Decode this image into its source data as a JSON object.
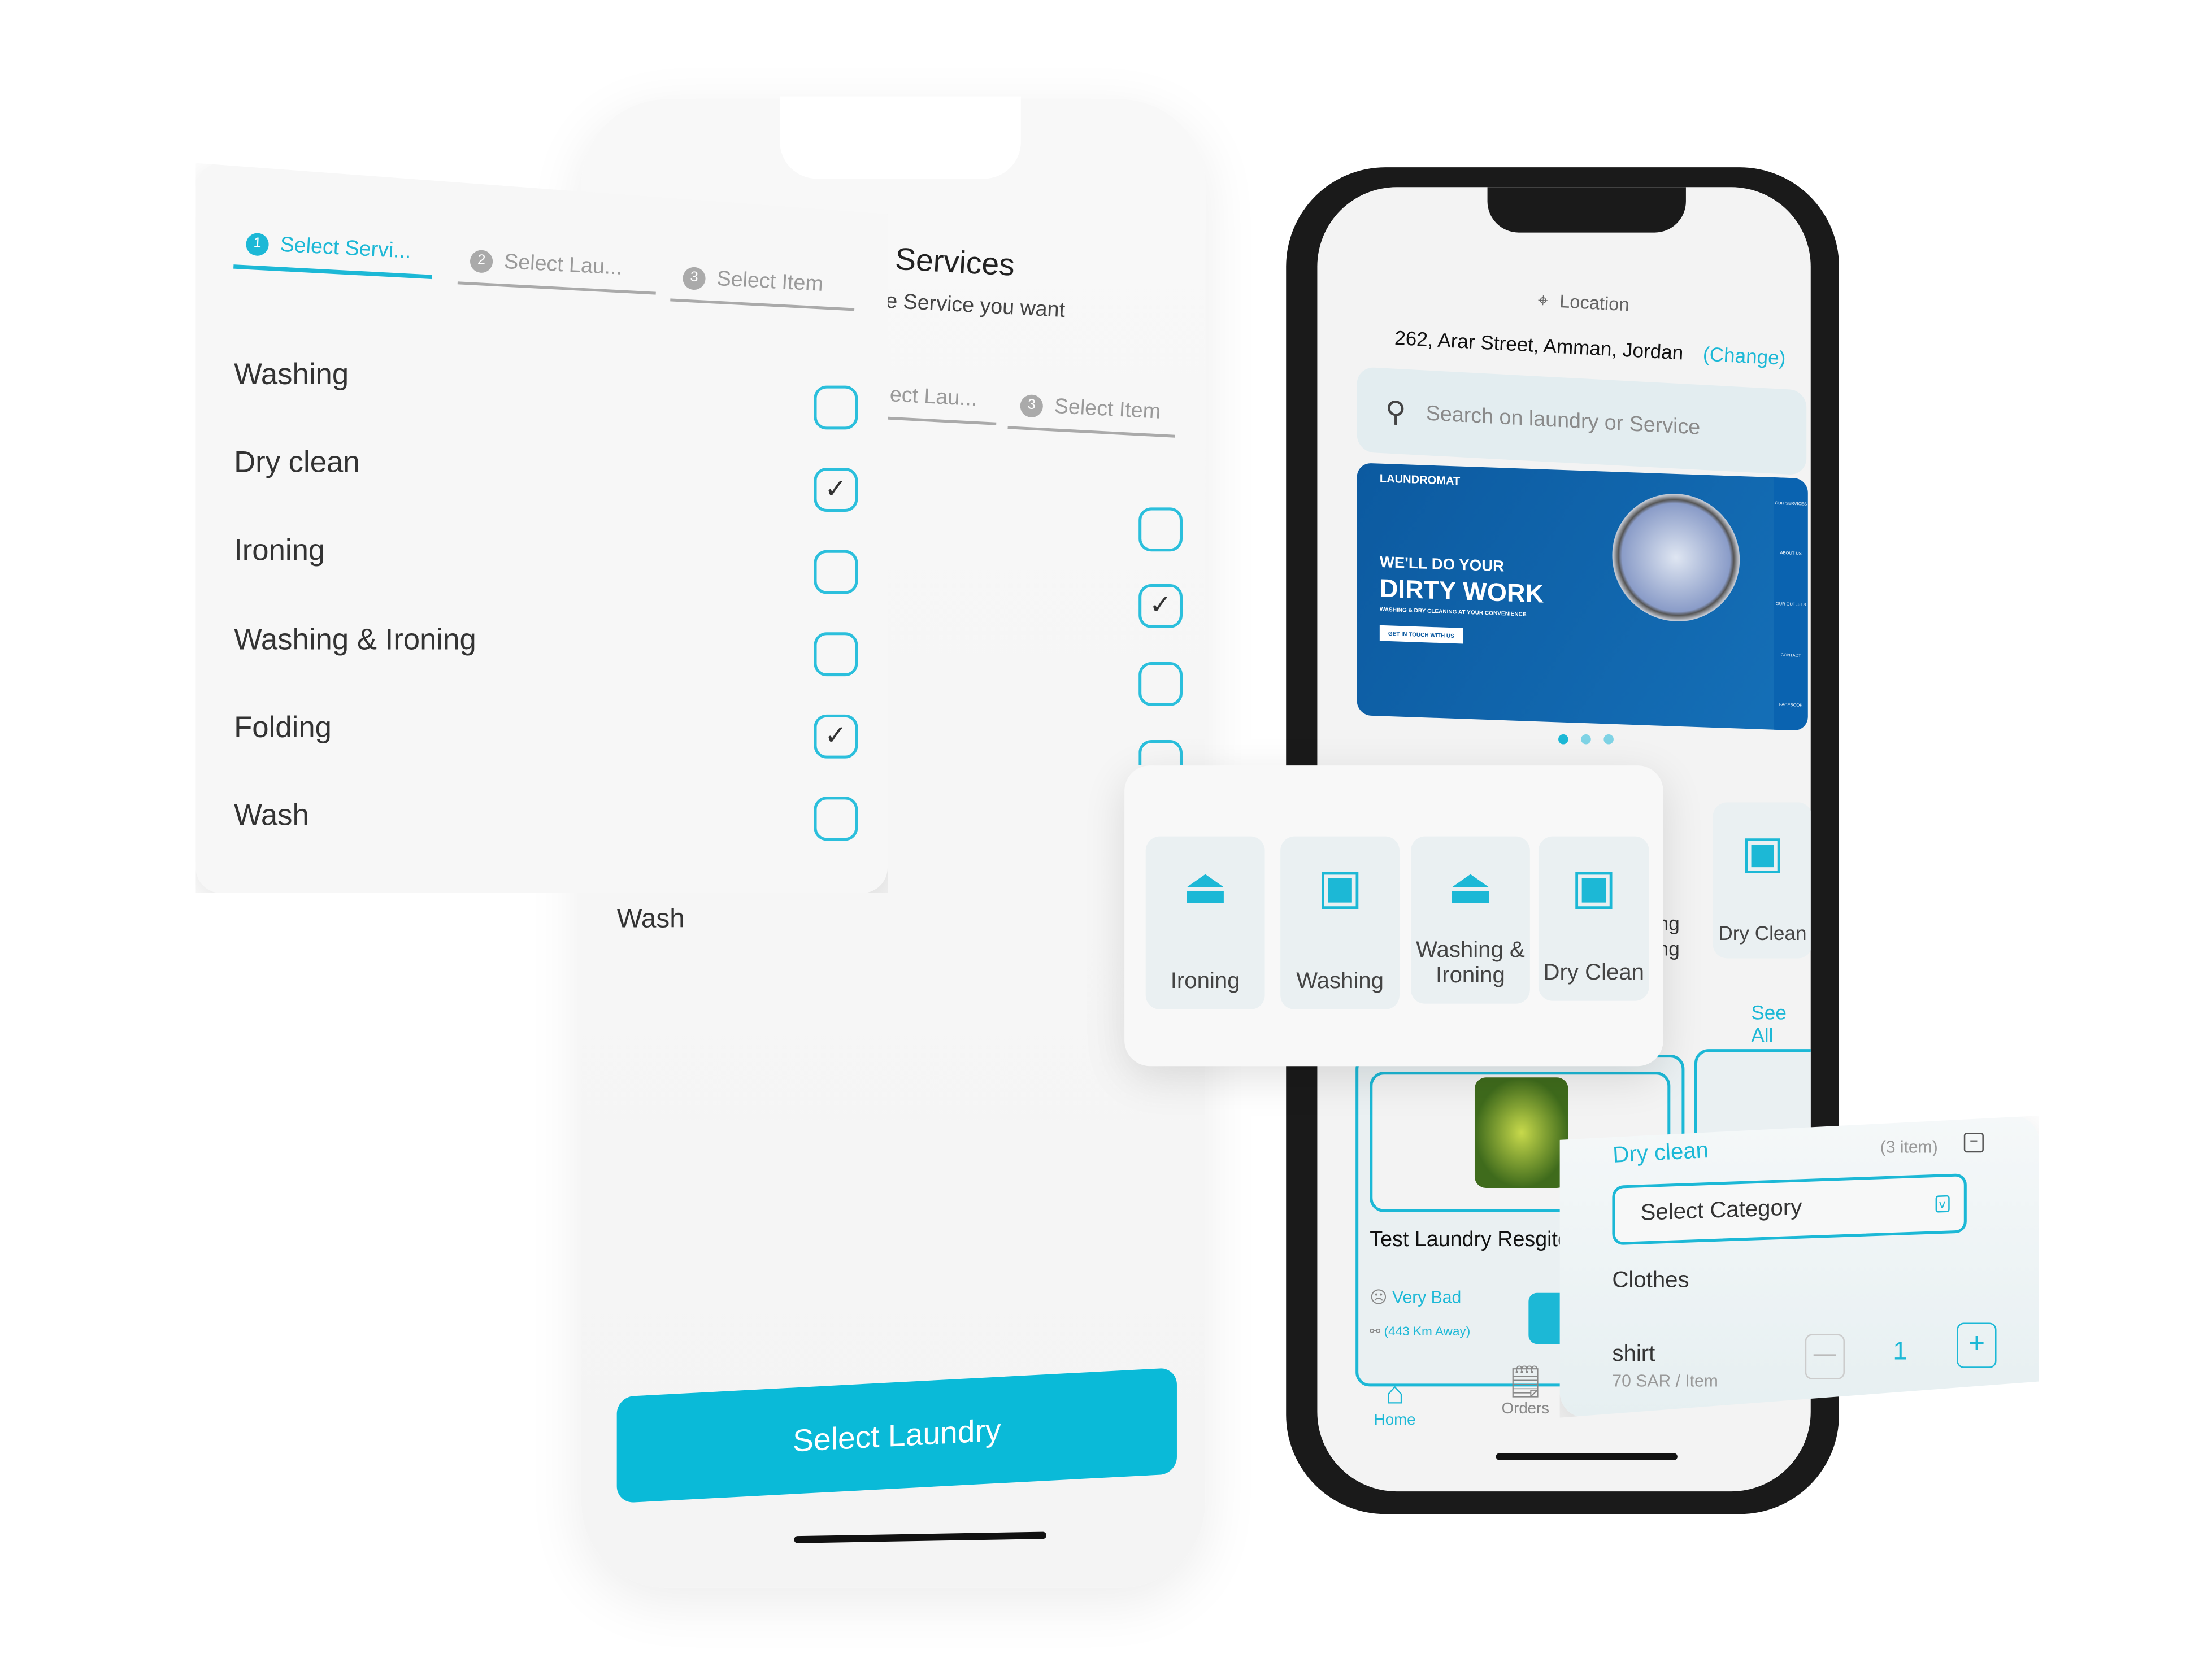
{
  "colors": {
    "accent": "#1cb8d6",
    "banner": "#0d5ea6",
    "text": "#333333"
  },
  "steps": [
    {
      "num": "1",
      "label": "Select Servi..."
    },
    {
      "num": "2",
      "label": "Select Lau..."
    },
    {
      "num": "3",
      "label": "Select Item"
    }
  ],
  "back_screen": {
    "title": "Services",
    "subtitle": "e Service you want",
    "tab_partial": "ect Lau...",
    "tab_item": "Select Item",
    "wash_label": "Wash",
    "button": "Select Laundry"
  },
  "services": [
    {
      "label": "Washing",
      "checked": false
    },
    {
      "label": "Dry clean",
      "checked": true
    },
    {
      "label": "Ironing",
      "checked": false
    },
    {
      "label": "Washing & Ironing",
      "checked": false
    },
    {
      "label": "Folding",
      "checked": true
    },
    {
      "label": "Wash",
      "checked": false
    }
  ],
  "home": {
    "location_label": "Location",
    "address": "262, Arar Street, Amman, Jordan",
    "change": "(Change)",
    "search_placeholder": "Search on laundry or Service",
    "banner": {
      "brand": "LAUNDROMAT",
      "line1": "WE'LL DO YOUR",
      "line2": "DIRTY WORK",
      "line3": "WASHING & DRY CLEANING AT YOUR CONVENIENCE",
      "cta": "GET IN TOUCH WITH US",
      "side": [
        "OUR SERVICES",
        "ABOUT US",
        "OUR OUTLETS",
        "CONTACT",
        "FACEBOOK"
      ]
    },
    "carousel": {
      "pages": 3,
      "active": 1
    },
    "behind_tile_partial": "ng\nng",
    "behind_tile": "Dry Clean",
    "see_all": "See All",
    "laundry": {
      "name": "Test Laundry Resgite",
      "rating": "Very Bad",
      "distance": "(443 Km Away)"
    },
    "nav": [
      {
        "label": "Home",
        "icon": "home-icon",
        "active": true
      },
      {
        "label": "Orders",
        "icon": "receipt-icon",
        "active": false
      }
    ]
  },
  "categories": [
    {
      "label": "Ironing",
      "icon": "iron-icon"
    },
    {
      "label": "Washing",
      "icon": "washing-machine-icon"
    },
    {
      "label": "Washing & Ironing",
      "icon": "iron-icon"
    },
    {
      "label": "Dry Clean",
      "icon": "washing-machine-icon"
    }
  ],
  "cart": {
    "service": "Dry clean",
    "count": "(3 item)",
    "select_placeholder": "Select Category",
    "category": "Clothes",
    "item": "shirt",
    "price": "70 SAR / Item",
    "qty": "1"
  }
}
